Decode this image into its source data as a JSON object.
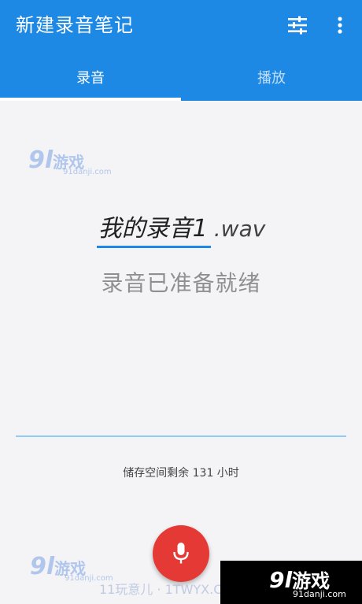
{
  "appbar": {
    "title": "新建录音笔记",
    "tune_icon": "tune-icon",
    "more_icon": "more-vert-icon"
  },
  "tabs": [
    {
      "label": "录音",
      "selected": true
    },
    {
      "label": "播放",
      "selected": false
    }
  ],
  "recorder": {
    "filename": "我的录音1",
    "extension": ".wav",
    "status": "录音已准备就绪",
    "storage": "储存空间剩余 131 小时",
    "mic_icon": "microphone-icon"
  },
  "watermarks": {
    "logo_num": "9l",
    "logo_text": "游戏",
    "logo_site": "91danji.com",
    "strip": "11玩意儿 · 1TWYX.COM"
  },
  "colors": {
    "primary": "#1e88e5",
    "accent": "#e53935",
    "progress": "#90caf9",
    "background": "#f4f4f6"
  }
}
